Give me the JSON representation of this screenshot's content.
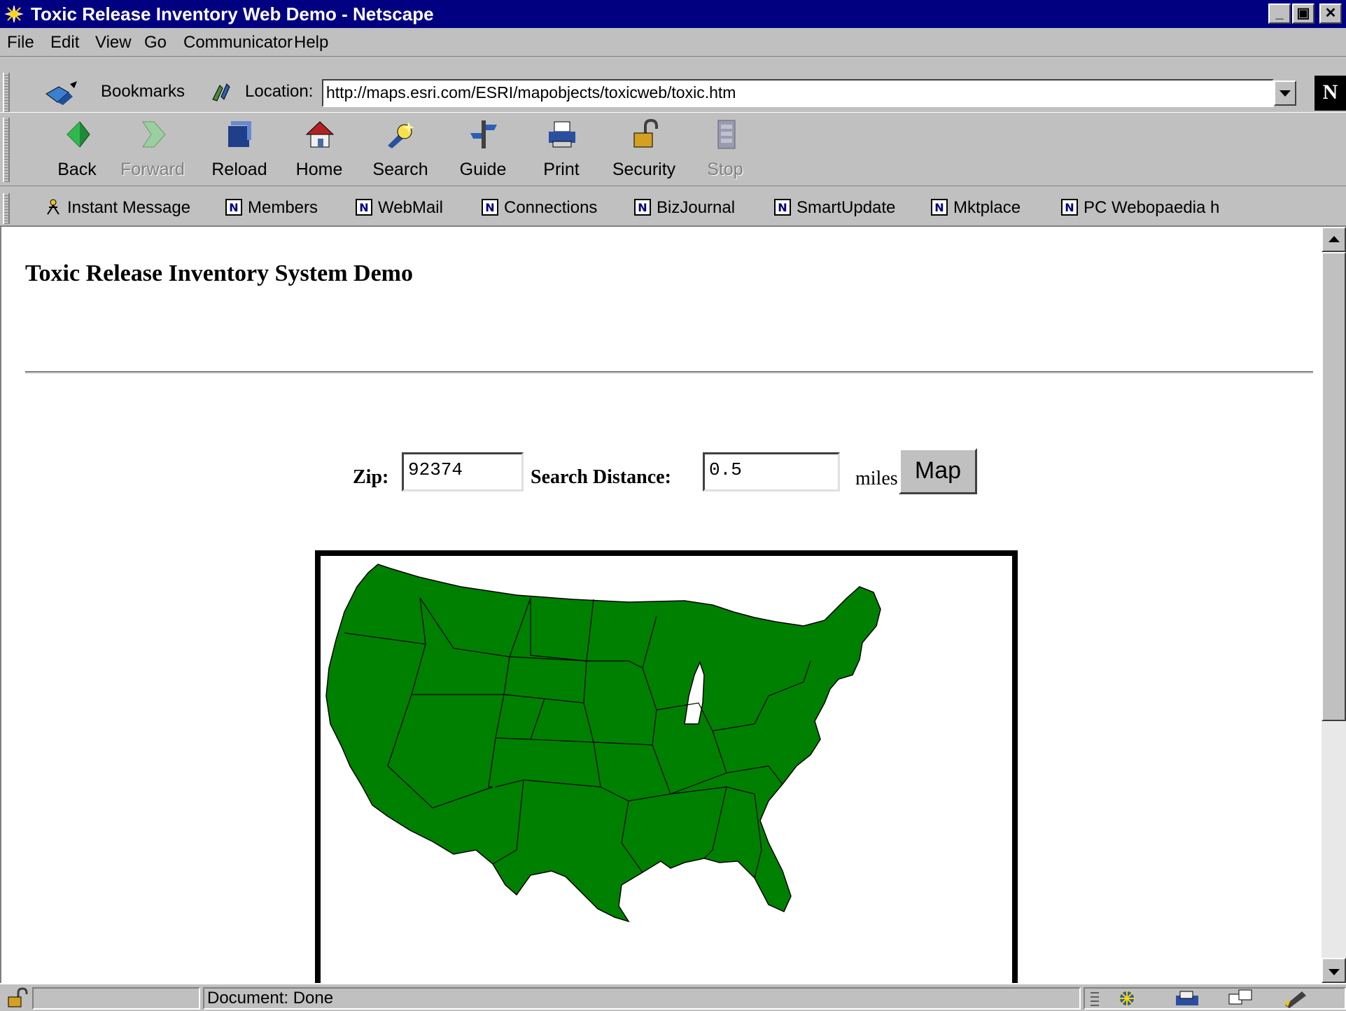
{
  "window": {
    "title": "Toxic Release Inventory Web Demo - Netscape",
    "minimize": "_",
    "maximize": "▣",
    "close": "✕"
  },
  "menu": [
    "File",
    "Edit",
    "View",
    "Go",
    "Communicator",
    "Help"
  ],
  "location": {
    "bookmarks_label": "Bookmarks",
    "location_label": "Location:",
    "url": "http://maps.esri.com/ESRI/mapobjects/toxicweb/toxic.htm",
    "logo": "N"
  },
  "navigation": [
    {
      "label": "Back",
      "icon": "back-arrow-icon",
      "enabled": true
    },
    {
      "label": "Forward",
      "icon": "forward-arrow-icon",
      "enabled": false
    },
    {
      "label": "Reload",
      "icon": "reload-icon",
      "enabled": true
    },
    {
      "label": "Home",
      "icon": "home-icon",
      "enabled": true
    },
    {
      "label": "Search",
      "icon": "search-icon",
      "enabled": true
    },
    {
      "label": "Guide",
      "icon": "guide-icon",
      "enabled": true
    },
    {
      "label": "Print",
      "icon": "printer-icon",
      "enabled": true
    },
    {
      "label": "Security",
      "icon": "lock-icon",
      "enabled": true
    },
    {
      "label": "Stop",
      "icon": "stop-icon",
      "enabled": false
    }
  ],
  "personal_toolbar": [
    "Instant Message",
    "Members",
    "WebMail",
    "Connections",
    "BizJournal",
    "SmartUpdate",
    "Mktplace",
    "PC Webopaedia h"
  ],
  "page": {
    "title": "Toxic Release Inventory System Demo",
    "zip_label": "Zip:",
    "zip_value": "92374",
    "distance_label": "Search Distance:",
    "distance_value": "0.5",
    "units": "miles",
    "map_button": "Map",
    "map_color": "#008000"
  },
  "status": {
    "text": "Document: Done"
  }
}
